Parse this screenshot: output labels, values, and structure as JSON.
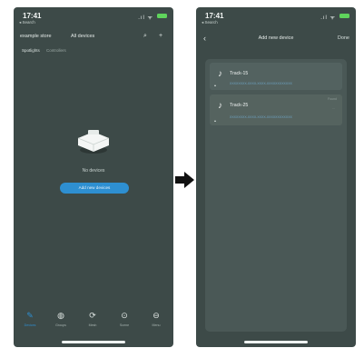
{
  "colors": {
    "phone_bg": "#3d4a48",
    "accent": "#2e8fd1",
    "battery": "#5fd45c"
  },
  "left_screen": {
    "status": {
      "time": "17:41",
      "back_app": "◂ Search"
    },
    "header": {
      "store": "example store",
      "all_devices": "All devices",
      "search_icon": "search-icon",
      "add_icon": "plus-icon"
    },
    "tabs": [
      {
        "label": "Spotlights"
      },
      {
        "label": "Controllers"
      }
    ],
    "empty_state": {
      "text": "No devices",
      "button": "Add new devices"
    },
    "tabbar": [
      {
        "label": "Devices",
        "icon": "pencil-icon"
      },
      {
        "label": "Groups",
        "icon": "group-icon"
      },
      {
        "label": "Mesh",
        "icon": "mesh-icon"
      },
      {
        "label": "Scene",
        "icon": "scene-icon"
      },
      {
        "label": "Menu",
        "icon": "menu-icon"
      }
    ]
  },
  "right_screen": {
    "status": {
      "time": "17:41",
      "back_app": "◂ Search"
    },
    "header": {
      "title": "Add new device",
      "done": "Done"
    },
    "devices": [
      {
        "name": "Track-15",
        "id": "XXXXXXXX-XXXX-XXXX-XXXXXXXXXXXX",
        "status": "",
        "sub": ""
      },
      {
        "name": "Track-25",
        "id": "XXXXXXXX-XXXX-XXXX-XXXXXXXXXXXX",
        "status": "Found",
        "sub": "..."
      }
    ]
  }
}
